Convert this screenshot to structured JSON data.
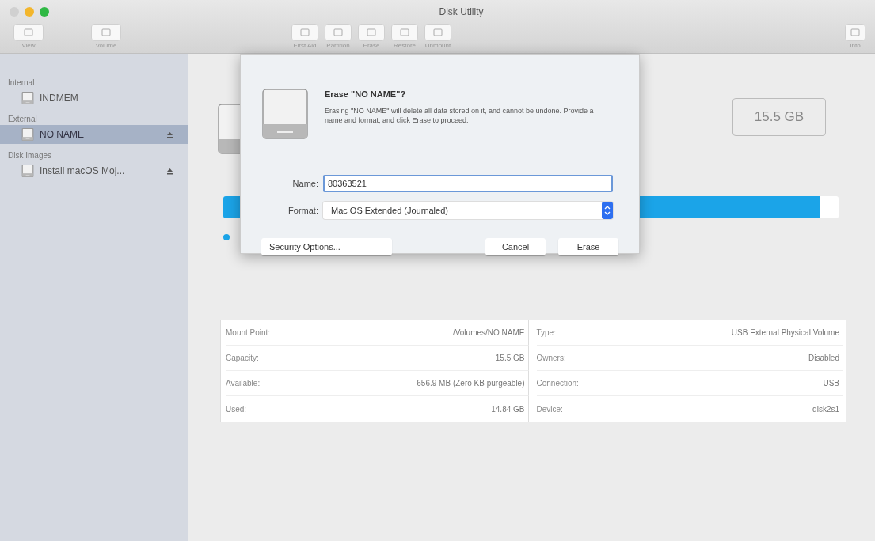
{
  "window": {
    "title": "Disk Utility"
  },
  "toolbar": {
    "left": [
      {
        "label": "View"
      },
      {
        "label": "Volume"
      }
    ],
    "center": [
      {
        "label": "First Aid"
      },
      {
        "label": "Partition"
      },
      {
        "label": "Erase"
      },
      {
        "label": "Restore"
      },
      {
        "label": "Unmount"
      }
    ],
    "right": [
      {
        "label": "Info"
      }
    ]
  },
  "sidebar": {
    "sections": [
      {
        "title": "Internal",
        "items": [
          {
            "name": "INDMEM",
            "selected": false,
            "ejectable": false
          }
        ]
      },
      {
        "title": "External",
        "items": [
          {
            "name": "NO NAME",
            "selected": true,
            "ejectable": true
          }
        ]
      },
      {
        "title": "Disk Images",
        "items": [
          {
            "name": "Install macOS Moj...",
            "selected": false,
            "ejectable": true
          }
        ]
      }
    ]
  },
  "volume": {
    "size": "15.5 GB",
    "usage": {
      "level": 0.97
    }
  },
  "info_table": {
    "rows": [
      {
        "label": "Mount Point:",
        "value": "/Volumes/NO NAME",
        "label_2": "Type:",
        "value_2": "USB External Physical Volume"
      },
      {
        "label": "Capacity:",
        "value": "15.5 GB",
        "label_2": "Owners:",
        "value_2": "Disabled"
      },
      {
        "label": "Available:",
        "value": "656.9 MB (Zero KB purgeable)",
        "label_2": "Connection:",
        "value_2": "USB"
      },
      {
        "label": "Used:",
        "value": "14.84 GB",
        "label_2": "Device:",
        "value_2": "disk2s1"
      }
    ]
  },
  "dialog": {
    "title": "Erase \"NO NAME\"?",
    "message": "Erasing \"NO NAME\" will delete all data stored on it, and cannot be undone. Provide a name and format, and click Erase to proceed.",
    "name_label": "Name:",
    "name_value": "80363521",
    "format_label": "Format:",
    "format_value": "Mac OS Extended (Journaled)",
    "buttons": [
      {
        "label": "Security Options...",
        "kind": "left"
      },
      {
        "label": "Cancel",
        "kind": "normal"
      },
      {
        "label": "Erase",
        "kind": "normal"
      }
    ]
  }
}
